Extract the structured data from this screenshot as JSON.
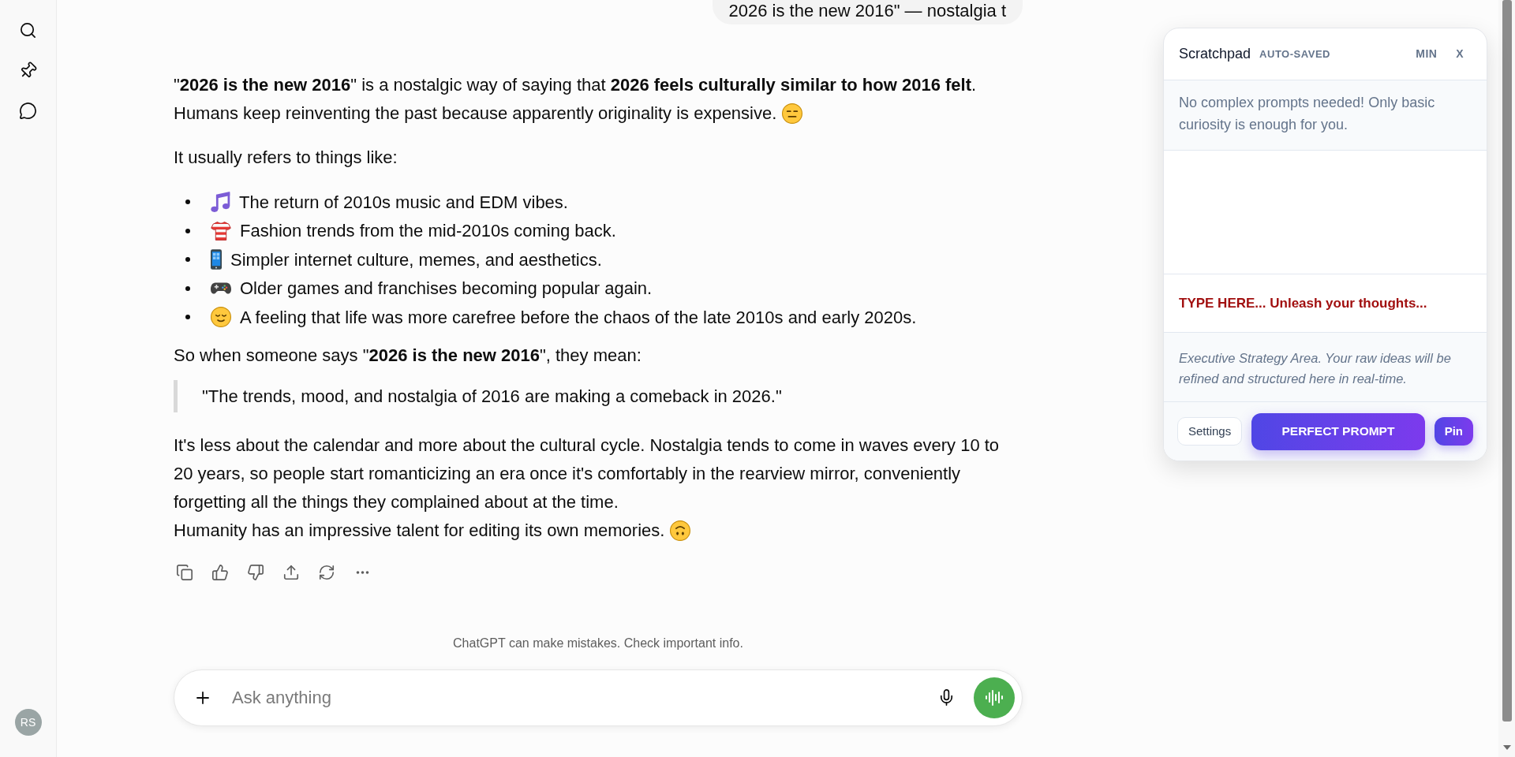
{
  "sidebar": {
    "avatar": "RS"
  },
  "user_message": {
    "text": "2026 is the new 2016\" — nostalgia t"
  },
  "response": {
    "blocks": [
      {
        "kind": "paragraph",
        "parts": [
          {
            "kind": "text",
            "text": "\"**2026 is the new 2016**\" is a nostalgic way of saying that **2026 feels culturally similar to how 2016 felt**."
          },
          {
            "kind": "text",
            "text": "Humans keep reinventing the past because apparently originality is expensive."
          },
          {
            "kind": "expressionless_face"
          }
        ]
      },
      {
        "kind": "paragraph",
        "text": "It usually refers to things like:"
      },
      {
        "kind": "list",
        "items": [
          {
            "kind": "music",
            "text": "The return of 2010s music and EDM vibes."
          },
          {
            "kind": "shirt",
            "text": "Fashion trends from the mid-2010s coming back."
          },
          {
            "kind": "phone",
            "text": "Simpler internet culture, memes, and aesthetics."
          },
          {
            "kind": "gamepad",
            "text": "Older games and franchises becoming popular again."
          },
          {
            "kind": "relieved_face",
            "text": "A feeling that life was more carefree before the chaos of the late 2010s and early 2020s."
          }
        ]
      },
      {
        "kind": "paragraph",
        "text": "So when someone says \"**2026 is the new 2016**\", they mean:"
      },
      {
        "kind": "quote",
        "text": "\"The trends, mood, and nostalgia of 2016 are making a comeback in 2026.\""
      },
      {
        "kind": "paragraph",
        "parts": [
          {
            "kind": "text",
            "text": "It's less about the calendar and more about the cultural cycle. Nostalgia tends to come in waves every 10 to 20 years, so people start romanticizing an era once it's comfortably in the rearview mirror, conveniently forgetting all the things they complained about at the time."
          },
          {
            "kind": "text",
            "text": "Humanity has an impressive talent for editing its own memories."
          },
          {
            "kind": "upside_down_face"
          }
        ]
      }
    ]
  },
  "disclaimer": "ChatGPT can make mistakes. Check important info.",
  "composer": {
    "placeholder": "Ask anything"
  },
  "scratchpad": {
    "title": "Scratchpad",
    "status": "AUTO-SAVED",
    "header_buttons": [
      "MIN",
      "X"
    ],
    "notice": "No complex prompts needed! Only basic curiosity is enough for you.",
    "input": {
      "placeholder": "TYPE HERE... Unleash your thoughts..."
    },
    "output_hint": "Executive Strategy Area. Your raw ideas will be refined and structured here in real-time.",
    "buttons": [
      {
        "label": "Settings",
        "kind": "outline"
      },
      {
        "label": "PERFECT PROMPT",
        "kind": "primary"
      },
      {
        "label": "Pin",
        "kind": "accent"
      }
    ]
  }
}
